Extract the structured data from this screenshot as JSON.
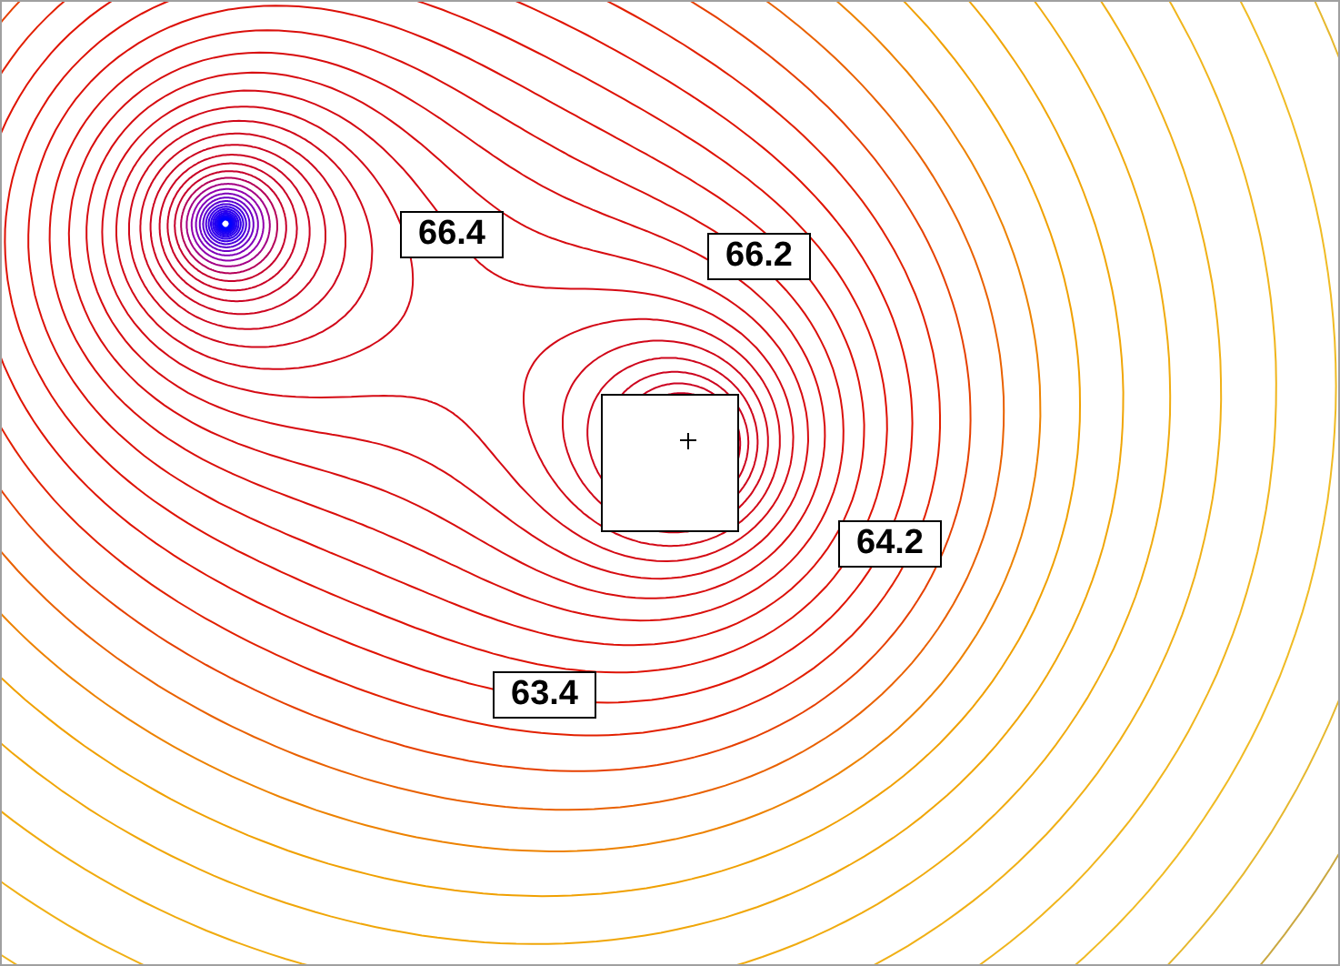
{
  "contour_plot": {
    "labels": [
      {
        "text": "66.4"
      },
      {
        "text": "66.2"
      },
      {
        "text": "64.2"
      },
      {
        "text": "63.4"
      }
    ]
  }
}
